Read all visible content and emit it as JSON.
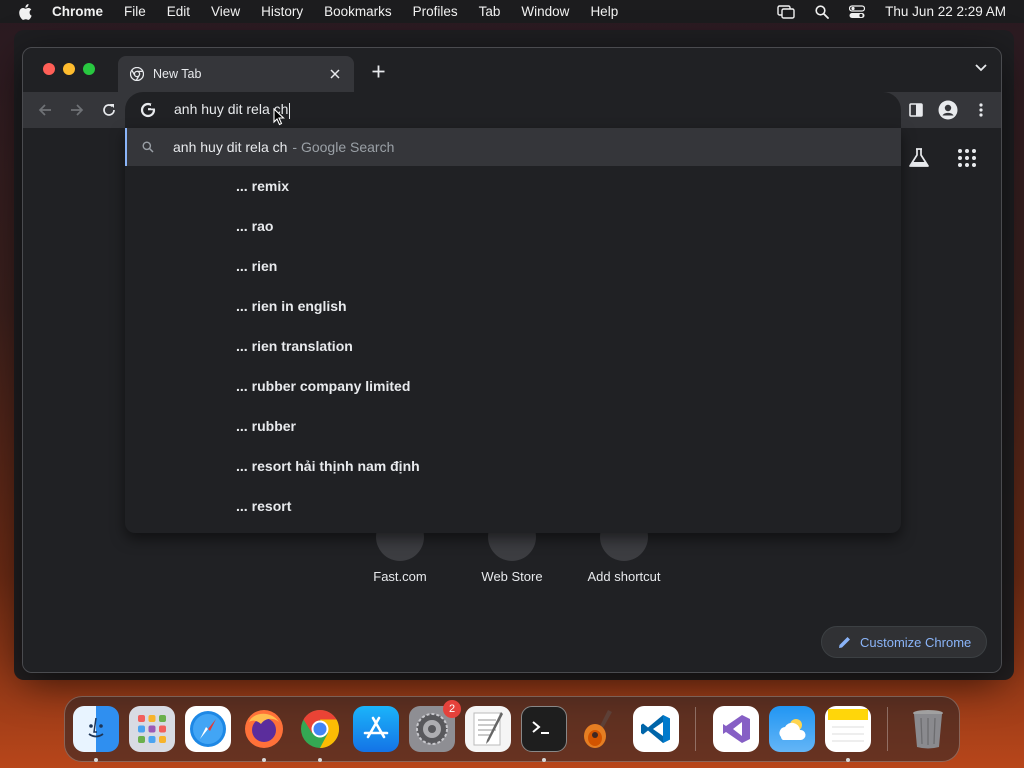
{
  "menubar": {
    "app": "Chrome",
    "items": [
      "File",
      "Edit",
      "View",
      "History",
      "Bookmarks",
      "Profiles",
      "Tab",
      "Window",
      "Help"
    ],
    "datetime": "Thu Jun 22  2:29 AM"
  },
  "browser": {
    "tab_title": "New Tab",
    "omnibox_text": "anh huy dit rela ch",
    "main_suggestion": {
      "query": "anh huy dit rela ch",
      "suffix": "- Google Search"
    },
    "suggestions": [
      {
        "prefix": "...",
        "rest": "remix"
      },
      {
        "prefix": "...",
        "rest": "rao"
      },
      {
        "prefix": "...",
        "rest": "rien"
      },
      {
        "prefix": "...",
        "rest": "rien in english"
      },
      {
        "prefix": "...",
        "rest": "rien translation"
      },
      {
        "prefix": "...",
        "rest": "rubber company limited"
      },
      {
        "prefix": "...",
        "rest": "rubber"
      },
      {
        "prefix": "...",
        "rest": "resort hải thịnh nam định"
      },
      {
        "prefix": "...",
        "rest": "resort"
      }
    ],
    "shortcuts": [
      "Fast.com",
      "Web Store",
      "Add shortcut"
    ],
    "customize_label": "Customize Chrome"
  },
  "dock": {
    "apps": [
      "finder-icon",
      "launchpad-icon",
      "safari-icon",
      "firefox-icon",
      "chrome-icon",
      "app-store-icon",
      "system-settings-icon",
      "textedit-icon",
      "terminal-icon",
      "garageband-icon",
      "vscode-icon",
      "visual-studio-icon",
      "weather-icon",
      "notes-icon",
      "trash-icon"
    ],
    "settings_badge": "2"
  }
}
